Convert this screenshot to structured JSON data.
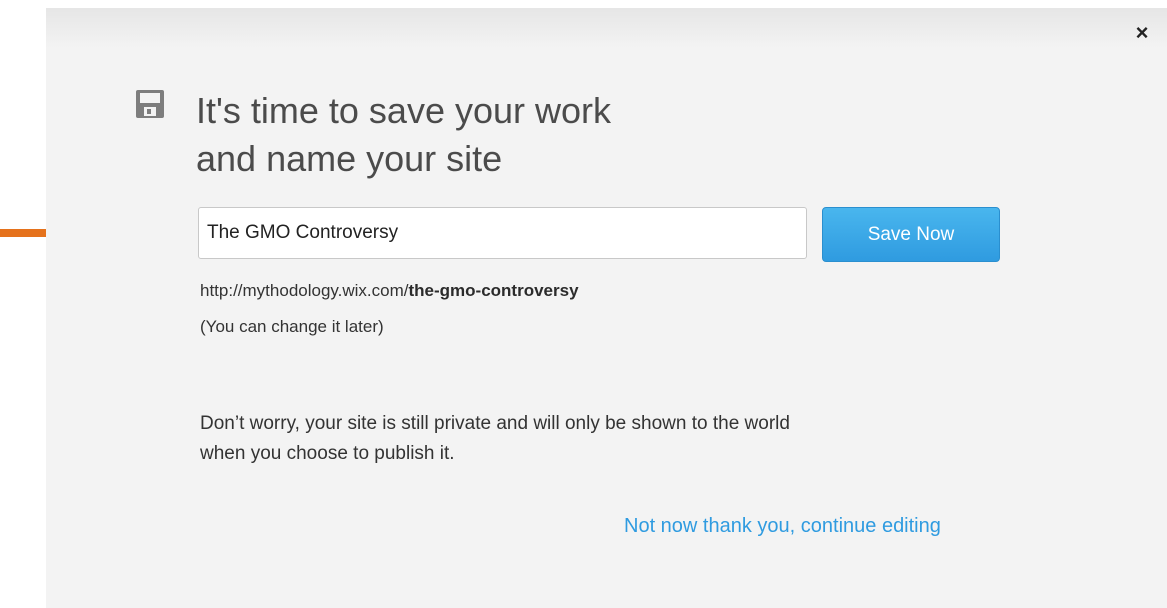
{
  "dialog": {
    "close_label": "×",
    "title_line1": "It's time to save your work",
    "title_line2": "and name your site",
    "site_name_value": "The GMO Controversy",
    "save_button_label": "Save Now",
    "url_prefix": "http://mythodology.wix.com/",
    "url_slug": "the-gmo-controversy",
    "change_note": "(You can change it later)",
    "privacy_line1": "Don’t worry, your site is still private and will only be shown to the world",
    "privacy_line2": "when you choose to publish it.",
    "skip_link_label": "Not now thank you, continue editing"
  },
  "icons": {
    "save": "floppy-disk-icon",
    "close": "close-icon",
    "pointer": "arrow-right-icon"
  },
  "colors": {
    "dialog_bg": "#f3f3f3",
    "accent_blue": "#2f9be0",
    "arrow_orange": "#e5721c",
    "title_gray": "#4b4b4b"
  }
}
